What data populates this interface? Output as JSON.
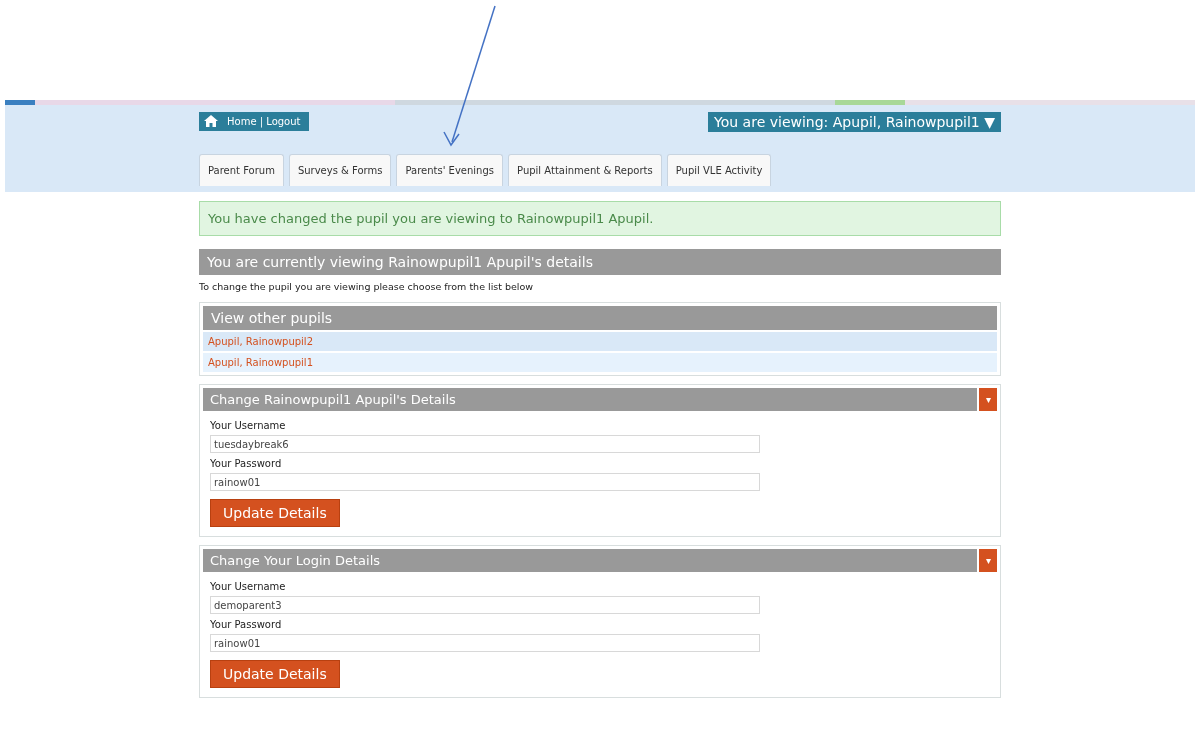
{
  "header": {
    "home_link": "Home | Logout",
    "viewing_button": "You are viewing: Apupil, Rainowpupil1 ▼"
  },
  "tabs": [
    {
      "label": "Parent Forum",
      "selected": false
    },
    {
      "label": "Surveys & Forms",
      "selected": false
    },
    {
      "label": "Parents' Evenings",
      "selected": false
    },
    {
      "label": "Pupil Attainment & Reports",
      "selected": false
    },
    {
      "label": "Pupil VLE Activity",
      "selected": false
    }
  ],
  "alert": "You have changed the pupil you are viewing to Rainowpupil1 Apupil.",
  "page_heading": "You are currently viewing Rainowpupil1 Apupil's details",
  "instruction": "To change the pupil you are viewing please choose from the list below",
  "other_pupils": {
    "title": "View other pupils",
    "items": [
      "Apupil, Rainowpupil2",
      "Apupil, Rainowpupil1"
    ]
  },
  "forms": [
    {
      "title": "Change Rainowpupil1 Apupil's Details",
      "toggle": "▾",
      "fields": [
        {
          "label": "Your Username",
          "value": "tuesdaybreak6"
        },
        {
          "label": "Your Password",
          "value": "rainow01"
        }
      ],
      "button": "Update Details"
    },
    {
      "title": "Change Your Login Details",
      "toggle": "▾",
      "fields": [
        {
          "label": "Your Username",
          "value": "demoparent3"
        },
        {
          "label": "Your Password",
          "value": "rainow01"
        }
      ],
      "button": "Update Details"
    }
  ]
}
